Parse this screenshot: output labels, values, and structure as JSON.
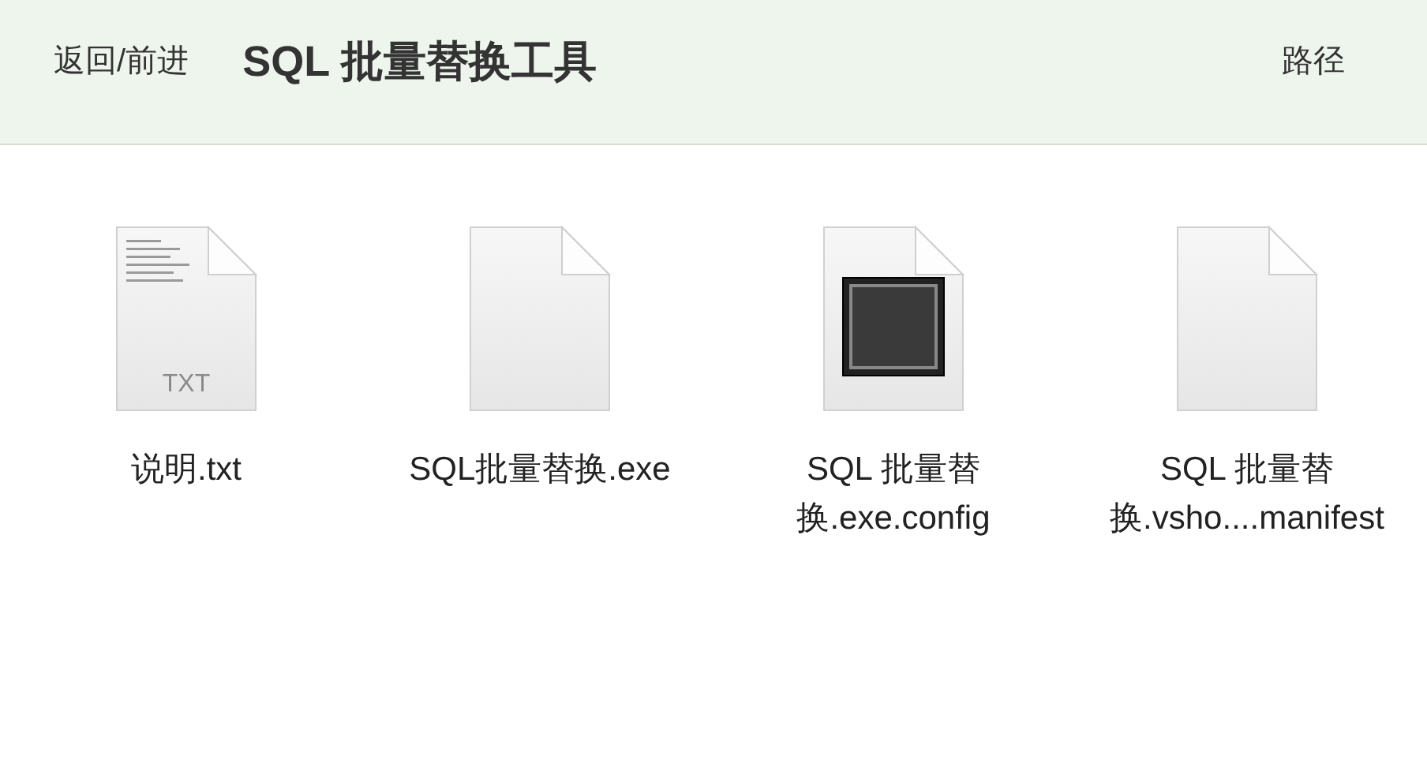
{
  "toolbar": {
    "nav": "返回/前进",
    "title": "SQL 批量替换工具",
    "path": "路径"
  },
  "files": [
    {
      "kind": "text",
      "icon_label": "TXT",
      "lines": [
        "说明.txt"
      ]
    },
    {
      "kind": "blank",
      "lines": [
        "SQL批量替换.exe"
      ]
    },
    {
      "kind": "app",
      "lines": [
        "SQL 批量替",
        "换.exe.config"
      ]
    },
    {
      "kind": "blank",
      "lines": [
        "SQL 批量替",
        "换.vsho....manifest"
      ]
    }
  ]
}
